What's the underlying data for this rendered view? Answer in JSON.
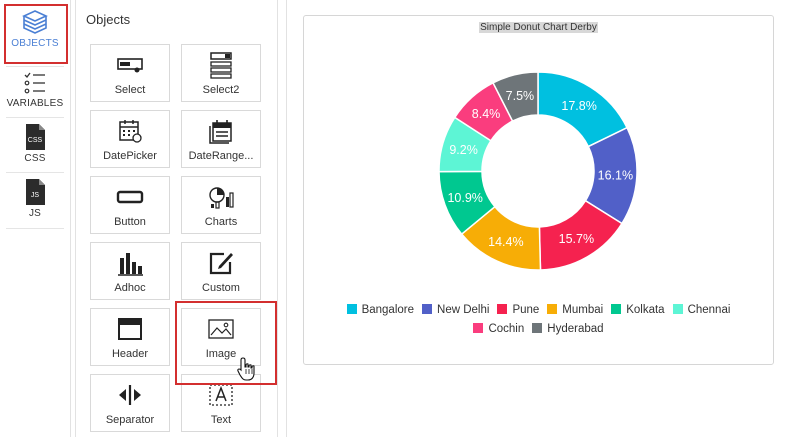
{
  "rail": {
    "items": [
      {
        "label": "OBJECTS",
        "icon": "layers-icon",
        "active": true
      },
      {
        "label": "VARIABLES",
        "icon": "list-icon"
      },
      {
        "label": "CSS",
        "icon": "css-file-icon"
      },
      {
        "label": "JS",
        "icon": "js-file-icon"
      }
    ]
  },
  "objects": {
    "title": "Objects",
    "tiles": [
      {
        "label": "Select",
        "icon": "select-icon"
      },
      {
        "label": "Select2",
        "icon": "select2-icon"
      },
      {
        "label": "DatePicker",
        "icon": "calendar-icon"
      },
      {
        "label": "DateRange...",
        "icon": "date-range-icon"
      },
      {
        "label": "Button",
        "icon": "button-icon"
      },
      {
        "label": "Charts",
        "icon": "charts-icon"
      },
      {
        "label": "Adhoc",
        "icon": "bar-chart-icon"
      },
      {
        "label": "Custom",
        "icon": "edit-icon"
      },
      {
        "label": "Header",
        "icon": "header-icon"
      },
      {
        "label": "Image",
        "icon": "image-icon"
      },
      {
        "label": "Separator",
        "icon": "separator-icon"
      },
      {
        "label": "Text",
        "icon": "text-icon"
      }
    ]
  },
  "chart_data": {
    "type": "pie",
    "title": "Simple Donut Chart Derby",
    "donut": true,
    "categories": [
      "Bangalore",
      "New Delhi",
      "Pune",
      "Mumbai",
      "Kolkata",
      "Chennai",
      "Cochin",
      "Hyderabad"
    ],
    "values": [
      17.8,
      16.1,
      15.7,
      14.4,
      10.9,
      9.2,
      8.4,
      7.5
    ],
    "labels": [
      "17.8%",
      "16.1%",
      "15.7%",
      "14.4%",
      "10.9%",
      "9.2%",
      "8.4%",
      "7.5%"
    ],
    "colors": [
      "#00c0e0",
      "#5160c8",
      "#f5224f",
      "#f7ad06",
      "#00c890",
      "#5df5d5",
      "#fa3d7e",
      "#6e7579"
    ],
    "legend_position": "bottom"
  }
}
